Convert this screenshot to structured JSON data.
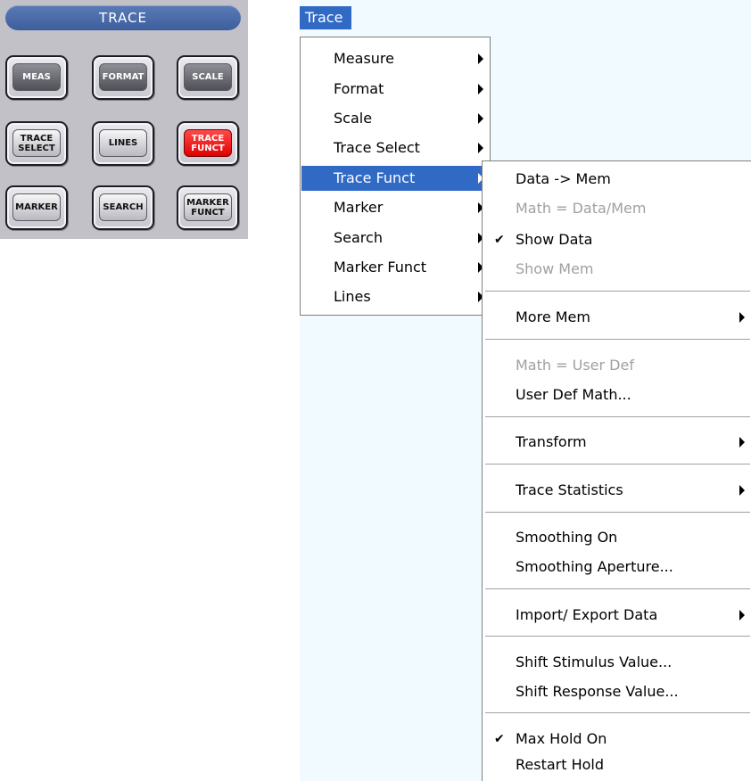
{
  "panel": {
    "title": "TRACE",
    "keys": {
      "meas": "MEAS",
      "format": "FORMAT",
      "scale": "SCALE",
      "trace_select": "TRACE\nSELECT",
      "lines": "LINES",
      "trace_funct": "TRACE\nFUNCT",
      "marker": "MARKER",
      "search": "SEARCH",
      "marker_funct": "MARKER\nFUNCT"
    },
    "active_key": "trace_funct",
    "active_color": "#e00000"
  },
  "menu": {
    "title": "Trace",
    "highlight_color": "#316ac5",
    "items": {
      "measure": "Measure",
      "format": "Format",
      "scale": "Scale",
      "trace_select": "Trace Select",
      "trace_funct": "Trace Funct",
      "marker": "Marker",
      "search": "Search",
      "marker_funct": "Marker Funct",
      "lines": "Lines"
    },
    "submenu": {
      "data_to_mem": "Data -> Mem",
      "math_data_mem": "Math = Data/Mem",
      "show_data": "Show Data",
      "show_mem": "Show Mem",
      "more_mem": "More Mem",
      "math_user_def": "Math = User Def",
      "user_def_math": "User Def Math...",
      "transform": "Transform",
      "trace_statistics": "Trace Statistics",
      "smoothing_on": "Smoothing On",
      "smoothing_aperture": "Smoothing Aperture...",
      "import_export_data": "Import/ Export Data",
      "shift_stimulus_value": "Shift Stimulus Value...",
      "shift_response_value": "Shift Response Value...",
      "max_hold_on": "Max Hold On",
      "restart_hold": "Restart Hold"
    },
    "checkmark": "✔"
  }
}
